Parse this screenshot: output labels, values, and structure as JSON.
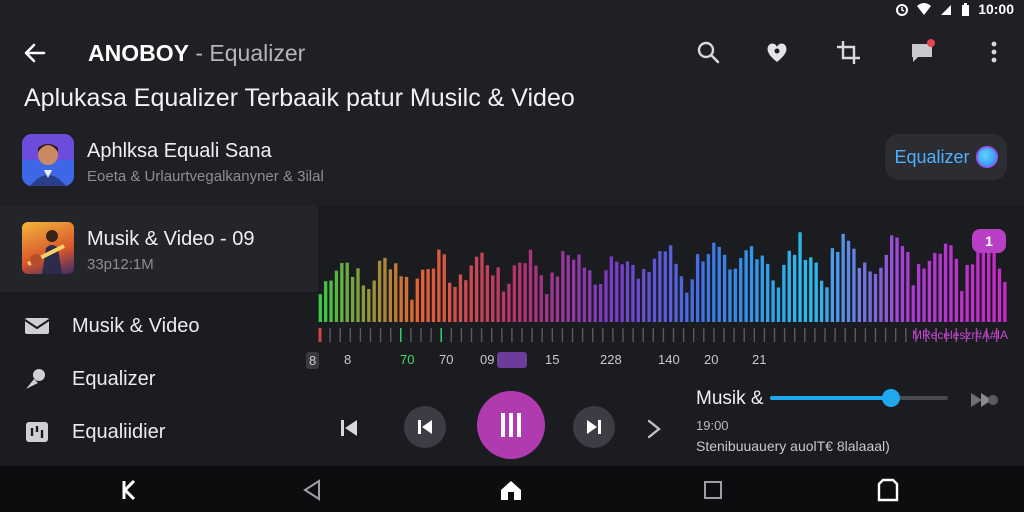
{
  "status_bar": {
    "time": "10:00",
    "icons": [
      "alarm-icon",
      "wifi-icon",
      "battery-icon"
    ]
  },
  "appbar": {
    "brand": "ANOBOY",
    "subtitle": " - Equalizer",
    "icons": [
      "search-icon",
      "heart-icon",
      "crop-icon",
      "notification-icon",
      "more-vert-icon"
    ]
  },
  "headline": "Aplukasa Equalizer Terbaaik patur Musilc & Video",
  "app": {
    "name": "Aphlksa Equali Sana",
    "description": "Eoeta & Urlaurtvegalkanyner & 3ilal",
    "button_label": "Equalizer"
  },
  "track": {
    "title": "Musik & Video - 09",
    "size": "33p12:1M"
  },
  "menu": [
    {
      "label": "Musik & Video",
      "icon": "mail-icon"
    },
    {
      "label": "Equalizer",
      "icon": "voice-icon"
    },
    {
      "label": "Equaliidier",
      "icon": "equalizer-icon"
    }
  ],
  "visualizer": {
    "badge": "1",
    "marker_label": "MReceleszr#A#IA",
    "ticks": [
      "8",
      "8",
      "70",
      "70",
      "09",
      "15",
      "228",
      "140",
      "20",
      "21"
    ]
  },
  "now_playing": {
    "title": "Musik &",
    "time": "19:00",
    "info": "Stenibuuauery auolT€ 8lalaaal)",
    "volume": 0.68
  },
  "colors": {
    "background": "#1f2024",
    "accent_play": "#b03bb0",
    "accent_blue": "#1fa7f0",
    "badge": "#b93fc4"
  }
}
